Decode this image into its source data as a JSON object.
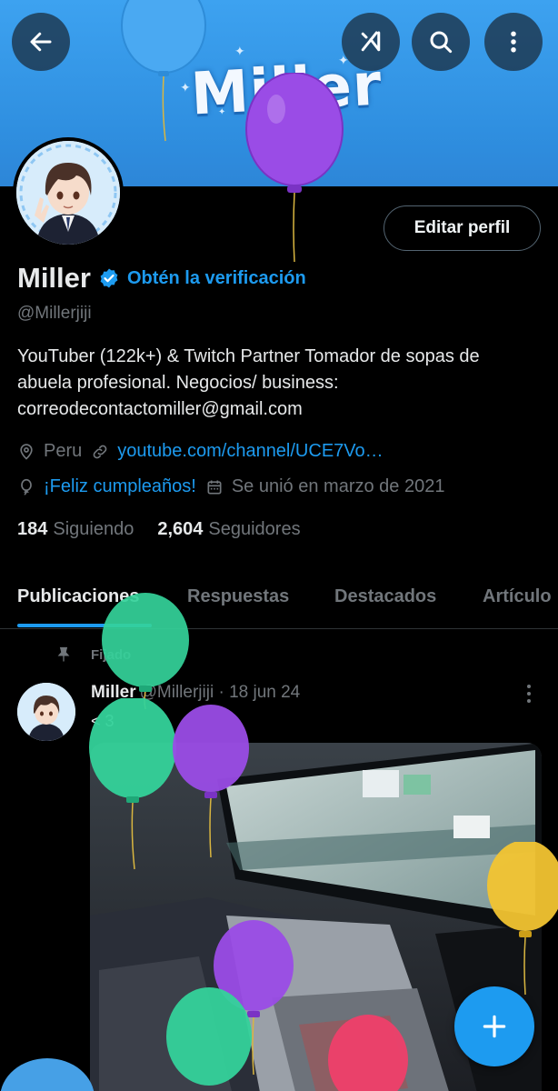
{
  "banner": {
    "text": "Miller"
  },
  "header": {
    "back_icon": "arrow-left-icon",
    "grok_icon": "grok-icon",
    "search_icon": "search-icon",
    "more_icon": "more-vertical-icon"
  },
  "profile": {
    "edit_label": "Editar perfil",
    "name": "Miller",
    "verify_label": "Obtén la verificación",
    "handle": "@Millerjiji",
    "bio": "YouTuber (122k+) & Twitch Partner Tomador de sopas de abuela profesional.  Negocios/ business: correodecontactomiller@gmail.com",
    "location": "Peru",
    "website": "youtube.com/channel/UCE7Vo…",
    "birthday": "¡Feliz cumpleaños!",
    "joined": "Se unió en marzo de 2021",
    "following_count": "184",
    "following_label": "Siguiendo",
    "followers_count": "2,604",
    "followers_label": "Seguidores"
  },
  "tabs": [
    {
      "label": "Publicaciones"
    },
    {
      "label": "Respuestas"
    },
    {
      "label": "Destacados"
    },
    {
      "label": "Artículo"
    }
  ],
  "post": {
    "pinned_label": "Fijado",
    "author": "Miller",
    "meta": "@Millerjiji · 18 jun 24",
    "text": "< 3"
  },
  "colors": {
    "accent": "#1d9bf0",
    "background": "#000000",
    "banner": "#3da2f0",
    "muted_text": "#71767b"
  }
}
